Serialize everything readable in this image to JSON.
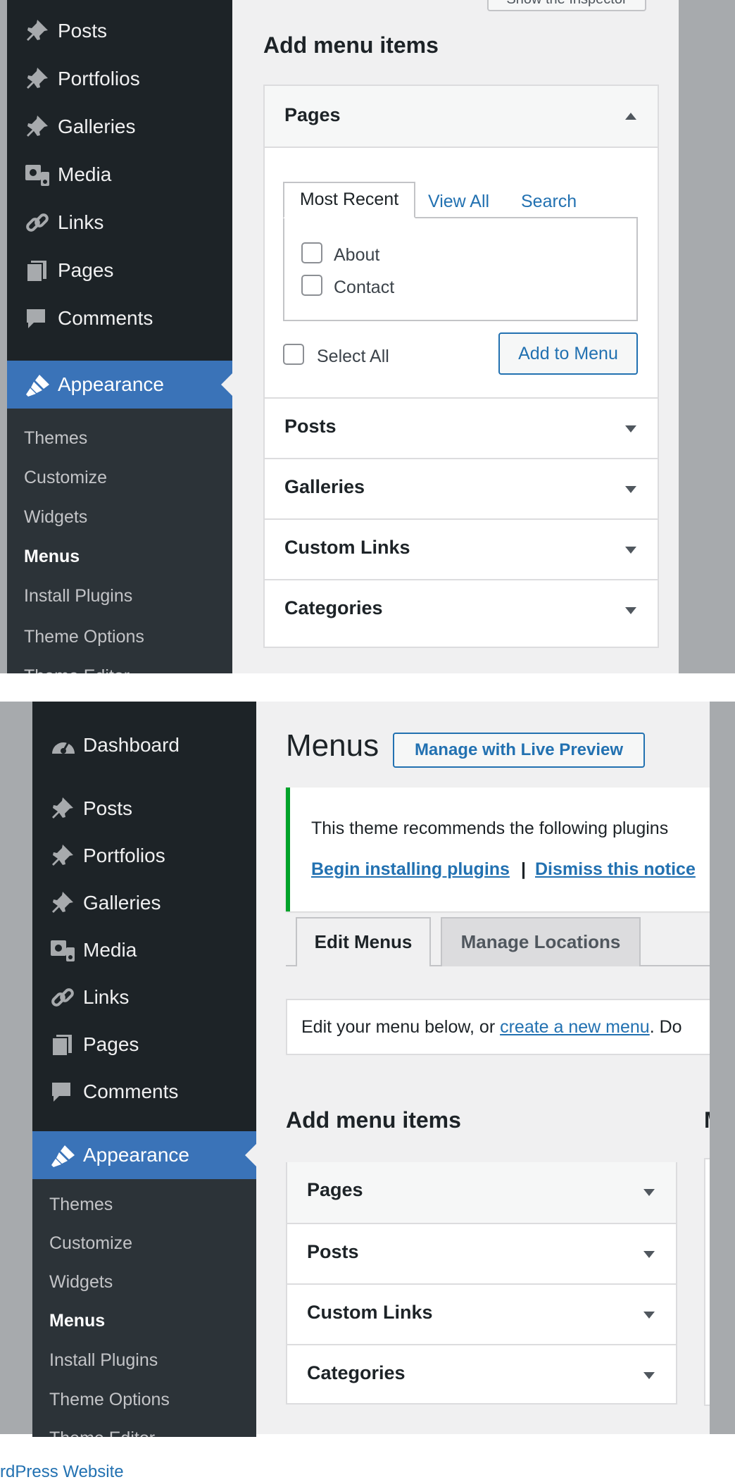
{
  "top_panel": {
    "tooltip": "Show the Inspector",
    "sidebar_items": [
      {
        "label": "Posts",
        "icon": "pin-icon"
      },
      {
        "label": "Portfolios",
        "icon": "pin-icon"
      },
      {
        "label": "Galleries",
        "icon": "pin-icon"
      },
      {
        "label": "Media",
        "icon": "media-icon"
      },
      {
        "label": "Links",
        "icon": "link-icon"
      },
      {
        "label": "Pages",
        "icon": "pages-icon"
      },
      {
        "label": "Comments",
        "icon": "comment-icon"
      }
    ],
    "appearance": "Appearance",
    "submenu": [
      "Themes",
      "Customize",
      "Widgets",
      "Menus",
      "Install Plugins",
      "Theme Options",
      "Theme Editor"
    ],
    "add_menu_items_title": "Add menu items",
    "pages_section": "Pages",
    "tabs": [
      "Most Recent",
      "View All",
      "Search"
    ],
    "page_options": [
      "About",
      "Contact"
    ],
    "select_all": "Select All",
    "add_to_menu": "Add to Menu",
    "sections": [
      "Posts",
      "Galleries",
      "Custom Links",
      "Categories"
    ]
  },
  "bottom_panel": {
    "sidebar_items": [
      {
        "label": "Dashboard",
        "icon": "dashboard-icon"
      },
      {
        "label": "Posts",
        "icon": "pin-icon"
      },
      {
        "label": "Portfolios",
        "icon": "pin-icon"
      },
      {
        "label": "Galleries",
        "icon": "pin-icon"
      },
      {
        "label": "Media",
        "icon": "media-icon"
      },
      {
        "label": "Links",
        "icon": "link-icon"
      },
      {
        "label": "Pages",
        "icon": "pages-icon"
      },
      {
        "label": "Comments",
        "icon": "comment-icon"
      }
    ],
    "appearance": "Appearance",
    "submenu": [
      "Themes",
      "Customize",
      "Widgets",
      "Menus",
      "Install Plugins",
      "Theme Options",
      "Theme Editor"
    ],
    "page_title": "Menus",
    "live_preview_button": "Manage with Live Preview",
    "notice_text": "This theme recommends the following plugins",
    "notice_link_install": "Begin installing plugins",
    "notice_sep": "|",
    "notice_link_dismiss": "Dismiss this notice",
    "tab_edit": "Edit Menus",
    "tab_locations": "Manage Locations",
    "edit_text_before": "Edit your menu below, or ",
    "edit_link": "create a new menu",
    "edit_text_after": ". Do",
    "add_menu_items_title": "Add menu items",
    "cut_heading": "M",
    "sections": [
      "Pages",
      "Posts",
      "Custom Links",
      "Categories"
    ],
    "footer_text": "rdPress Website"
  },
  "colors": {
    "sidebar_bg": "#1d2327",
    "submenu_bg": "#2c3338",
    "accent": "#2271b1",
    "active_menu": "#3a73b8",
    "notice_green": "#00a32a"
  }
}
